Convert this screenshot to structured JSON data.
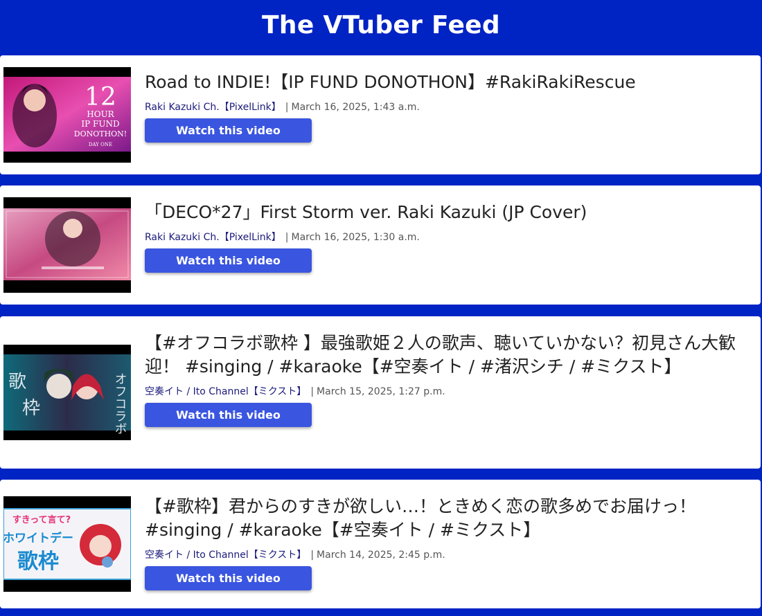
{
  "header": {
    "title": "The VTuber Feed"
  },
  "feed": [
    {
      "title": "Road to INDIE!【IP FUND DONOTHON】#RakiRakiRescue",
      "channel": "Raki Kazuki Ch.【PixelLink】",
      "date": "March 16, 2025, 1:43 a.m.",
      "button_label": "Watch this video",
      "thumb_text": [
        "12",
        "HOUR",
        "IP FUND",
        "DONOTHON!",
        "DAY ONE"
      ]
    },
    {
      "title": "「DECO*27」First Storm ver. Raki Kazuki (JP Cover)",
      "channel": "Raki Kazuki Ch.【PixelLink】",
      "date": "March 16, 2025, 1:30 a.m.",
      "button_label": "Watch this video"
    },
    {
      "title": "【#オフコラボ歌枠 】最強歌姫２人の歌声、聴いていかない？初見さん大歓迎！ #singing / #karaoke【#空奏イト / #渚沢シチ / #ミクスト】",
      "channel": "空奏イト / Ito Channel【ミクスト】",
      "date": "March 15, 2025, 1:27 p.m.",
      "button_label": "Watch this video",
      "thumb_text": [
        "歌",
        "枠",
        "オフコラボ"
      ]
    },
    {
      "title": "【#歌枠】君からのすきが欲しい…！ときめく恋の歌多めでお届けっ！ #singing / #karaoke【#空奏イト / #ミクスト】",
      "channel": "空奏イト / Ito Channel【ミクスト】",
      "date": "March 14, 2025, 2:45 p.m.",
      "button_label": "Watch this video",
      "thumb_text": [
        "すきって言て?",
        "ホワイトデー",
        "歌枠"
      ]
    }
  ],
  "colors": {
    "background": "#0023c4",
    "button": "#3a55e0",
    "card": "#ffffff"
  }
}
